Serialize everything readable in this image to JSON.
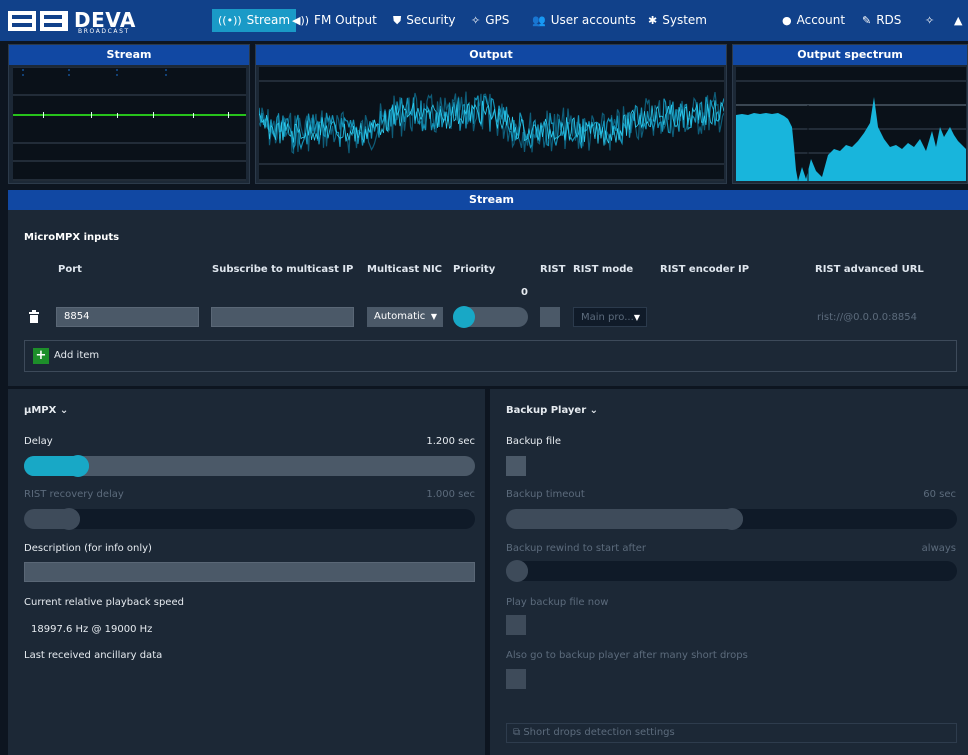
{
  "brand": {
    "name": "DEVA",
    "sub": "BROADCAST"
  },
  "nav": {
    "stream": "Stream",
    "fm_output": "FM Output",
    "security": "Security",
    "gps": "GPS",
    "user_accounts": "User accounts",
    "system": "System",
    "account": "Account",
    "rds": "RDS"
  },
  "panels": {
    "stream_title": "Stream",
    "output_title": "Output",
    "spectrum_title": "Output spectrum"
  },
  "stream_bar": "Stream",
  "inputs": {
    "title": "MicroMPX inputs",
    "columns": {
      "port": "Port",
      "subscribe": "Subscribe to multicast IP",
      "nic": "Multicast NIC",
      "priority": "Priority",
      "rist": "RIST",
      "rist_mode": "RIST mode",
      "rist_encoder_ip": "RIST encoder IP",
      "rist_advanced_url": "RIST advanced URL"
    },
    "row": {
      "port": "8854",
      "subscribe": "",
      "nic": "Automatic",
      "priority_value": "0",
      "priority_level": 0,
      "rist_mode": "Main pro...",
      "rist_advanced_url": "rist://@0.0.0.0:8854"
    },
    "add_item": "Add item"
  },
  "umpx": {
    "title": "µMPX",
    "delay_label": "Delay",
    "delay_value": "1.200 sec",
    "delay_fraction": 0.1,
    "rist_recovery_label": "RIST recovery delay",
    "rist_recovery_value": "1.000 sec",
    "rist_recovery_fraction": 0.08,
    "description_label": "Description (for info only)",
    "description_value": "",
    "speed_label": "Current relative playback speed",
    "speed_value": "18997.6 Hz @ 19000 Hz",
    "ancillary_label": "Last received ancillary data"
  },
  "backup": {
    "title": "Backup Player",
    "file_label": "Backup file",
    "timeout_label": "Backup timeout",
    "timeout_value": "60 sec",
    "timeout_fraction": 0.5,
    "rewind_label": "Backup rewind to start after",
    "rewind_value": "always",
    "rewind_fraction": 0.0,
    "play_now_label": "Play backup file now",
    "also_go_label": "Also go to backup player after many short drops",
    "short_drops_button": "Short drops detection settings"
  },
  "colors": {
    "nav_bg": "#11418a",
    "active_tab": "#1a9ac7",
    "accent": "#18a8c6",
    "green": "#27c21b",
    "panel_bg": "#1c2836"
  }
}
